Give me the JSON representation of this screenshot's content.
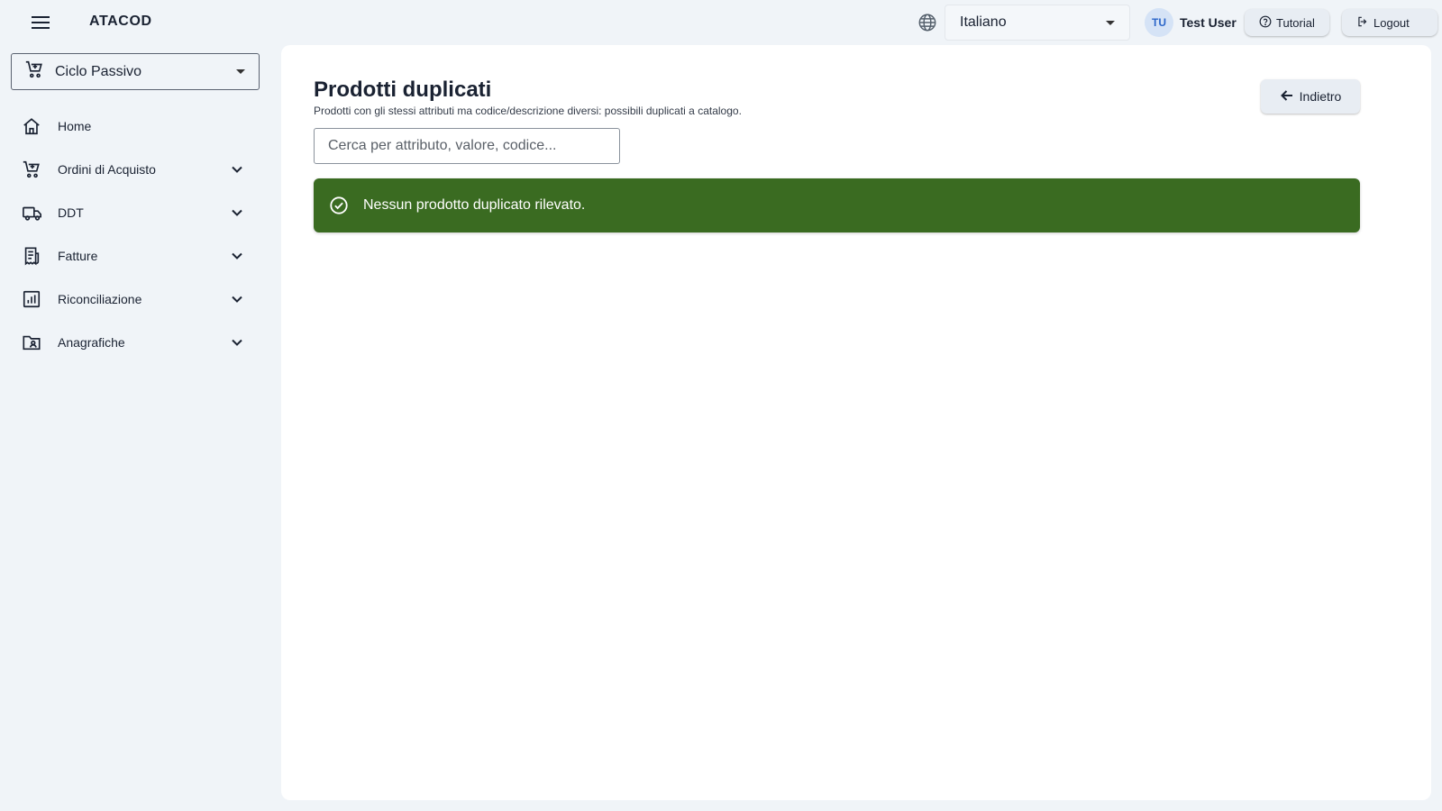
{
  "app": {
    "title": "ATACOD"
  },
  "header": {
    "language": {
      "selected": "Italiano"
    },
    "user": {
      "initials": "TU",
      "name": "Test User"
    },
    "tutorial_label": "Tutorial",
    "logout_label": "Logout"
  },
  "sidebar": {
    "cycle": {
      "selected": "Ciclo Passivo"
    },
    "items": [
      {
        "label": "Home",
        "icon": "home-icon",
        "expandable": false
      },
      {
        "label": "Ordini di Acquisto",
        "icon": "cart-icon",
        "expandable": true
      },
      {
        "label": "DDT",
        "icon": "truck-icon",
        "expandable": true
      },
      {
        "label": "Fatture",
        "icon": "receipt-icon",
        "expandable": true
      },
      {
        "label": "Riconciliazione",
        "icon": "chart-icon",
        "expandable": true
      },
      {
        "label": "Anagrafiche",
        "icon": "folder-person-icon",
        "expandable": true
      }
    ]
  },
  "main": {
    "title": "Prodotti duplicati",
    "subtitle": "Prodotti con gli stessi attributi ma codice/descrizione diversi: possibili duplicati a catalogo.",
    "back_label": "Indietro",
    "search": {
      "placeholder": "Cerca per attributo, valore, codice...",
      "value": ""
    },
    "alert": {
      "message": "Nessun prodotto duplicato rilevato.",
      "type": "success"
    }
  },
  "colors": {
    "background": "#f0f4f8",
    "surface": "#ffffff",
    "success": "#3a6b21",
    "text": "#1a2232",
    "avatar_bg": "#d5e3f6",
    "avatar_text": "#2b66c9"
  }
}
